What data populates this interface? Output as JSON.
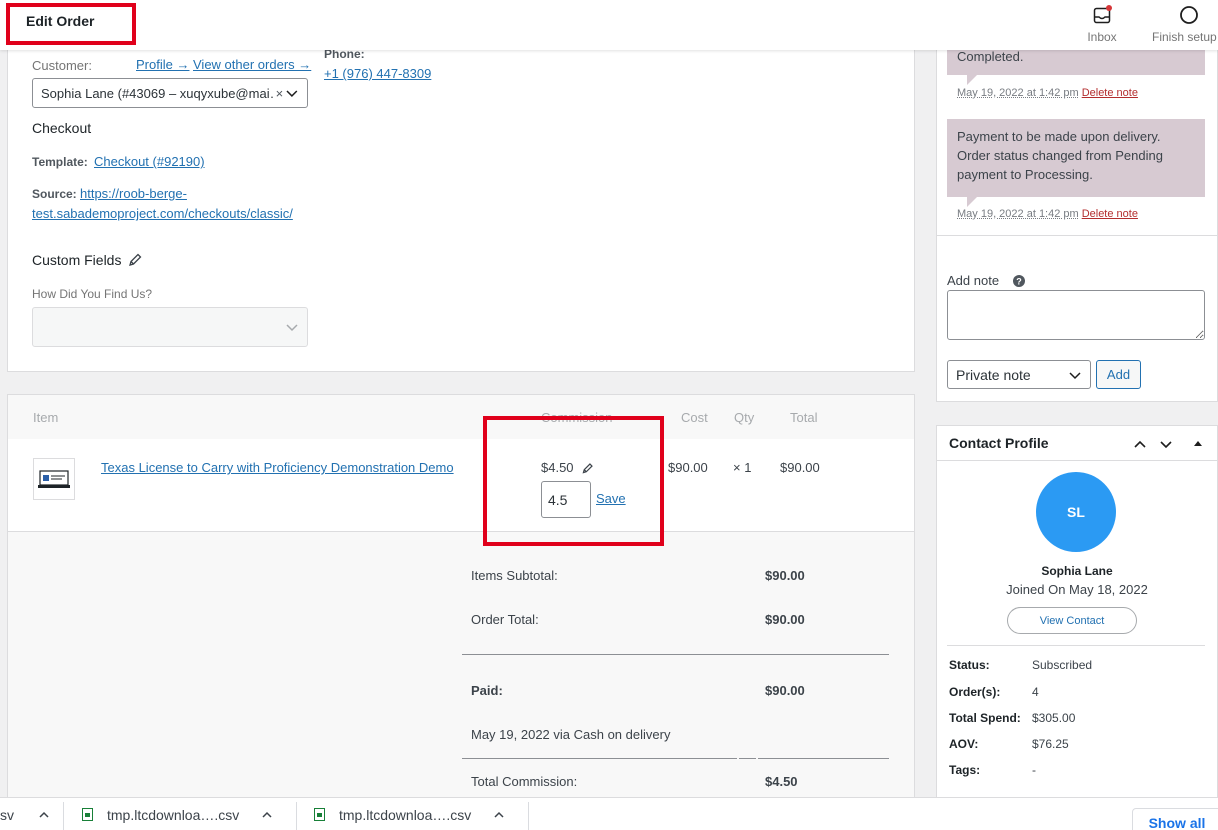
{
  "topbar": {
    "title": "Edit Order",
    "inbox_label": "Inbox",
    "finish_setup_label": "Finish setup"
  },
  "customer": {
    "label": "Customer:",
    "profile_link": "Profile →",
    "other_orders_link": "View other orders →",
    "selected": "Sophia Lane (#43069 – xuqyxube@mai…",
    "phone_label": "Phone:",
    "phone": "+1 (976) 447-8309"
  },
  "checkout": {
    "heading": "Checkout",
    "template_label": "Template:",
    "template_link": "Checkout (#92190)",
    "source_label": "Source:",
    "source_link_line1": "https://roob-berge-",
    "source_link_line2": "test.sabademoproject.com/checkouts/classic/"
  },
  "custom_fields": {
    "heading": "Custom Fields",
    "question": "How Did You Find Us?",
    "value": ""
  },
  "items": {
    "headers": {
      "item": "Item",
      "commission": "Commission",
      "cost": "Cost",
      "qty": "Qty",
      "total": "Total"
    },
    "rows": [
      {
        "name": "Texas License to Carry with Proficiency Demonstration Demo",
        "commission": "$4.50",
        "commission_input": "4.5",
        "save_label": "Save",
        "cost": "$90.00",
        "qty": "× 1",
        "total": "$90.00"
      }
    ]
  },
  "totals": {
    "items_subtotal_label": "Items Subtotal:",
    "items_subtotal": "$90.00",
    "order_total_label": "Order Total:",
    "order_total": "$90.00",
    "paid_label": "Paid:",
    "paid": "$90.00",
    "paid_note": "May 19, 2022 via Cash on delivery",
    "total_commission_label": "Total Commission:",
    "total_commission": "$4.50"
  },
  "notes": {
    "items": [
      {
        "text": "Completed.",
        "date": "May 19, 2022 at 1:42 pm",
        "delete": "Delete note"
      },
      {
        "text": "Payment to be made upon delivery. Order status changed from Pending payment to Processing.",
        "date": "May 19, 2022 at 1:42 pm",
        "delete": "Delete note"
      }
    ],
    "add_note_label": "Add note",
    "note_type": "Private note",
    "add_button": "Add"
  },
  "contact": {
    "heading": "Contact Profile",
    "initials": "SL",
    "name": "Sophia Lane",
    "joined": "Joined On May 18, 2022",
    "view_contact": "View Contact",
    "status_label": "Status:",
    "status": "Subscribed",
    "orders_label": "Order(s):",
    "orders": "4",
    "total_spend_label": "Total Spend:",
    "total_spend": "$305.00",
    "aov_label": "AOV:",
    "aov": "$76.25",
    "tags_label": "Tags:",
    "tags": "-"
  },
  "downloads": {
    "items": [
      "sv",
      "tmp.ltcdownloa….csv",
      "tmp.ltcdownloa….csv"
    ],
    "show_all": "Show all"
  },
  "colors": {
    "highlight": "#e0001b",
    "link": "#2271b1",
    "note_bg": "#d7cad2",
    "avatar": "#2b9af3"
  }
}
